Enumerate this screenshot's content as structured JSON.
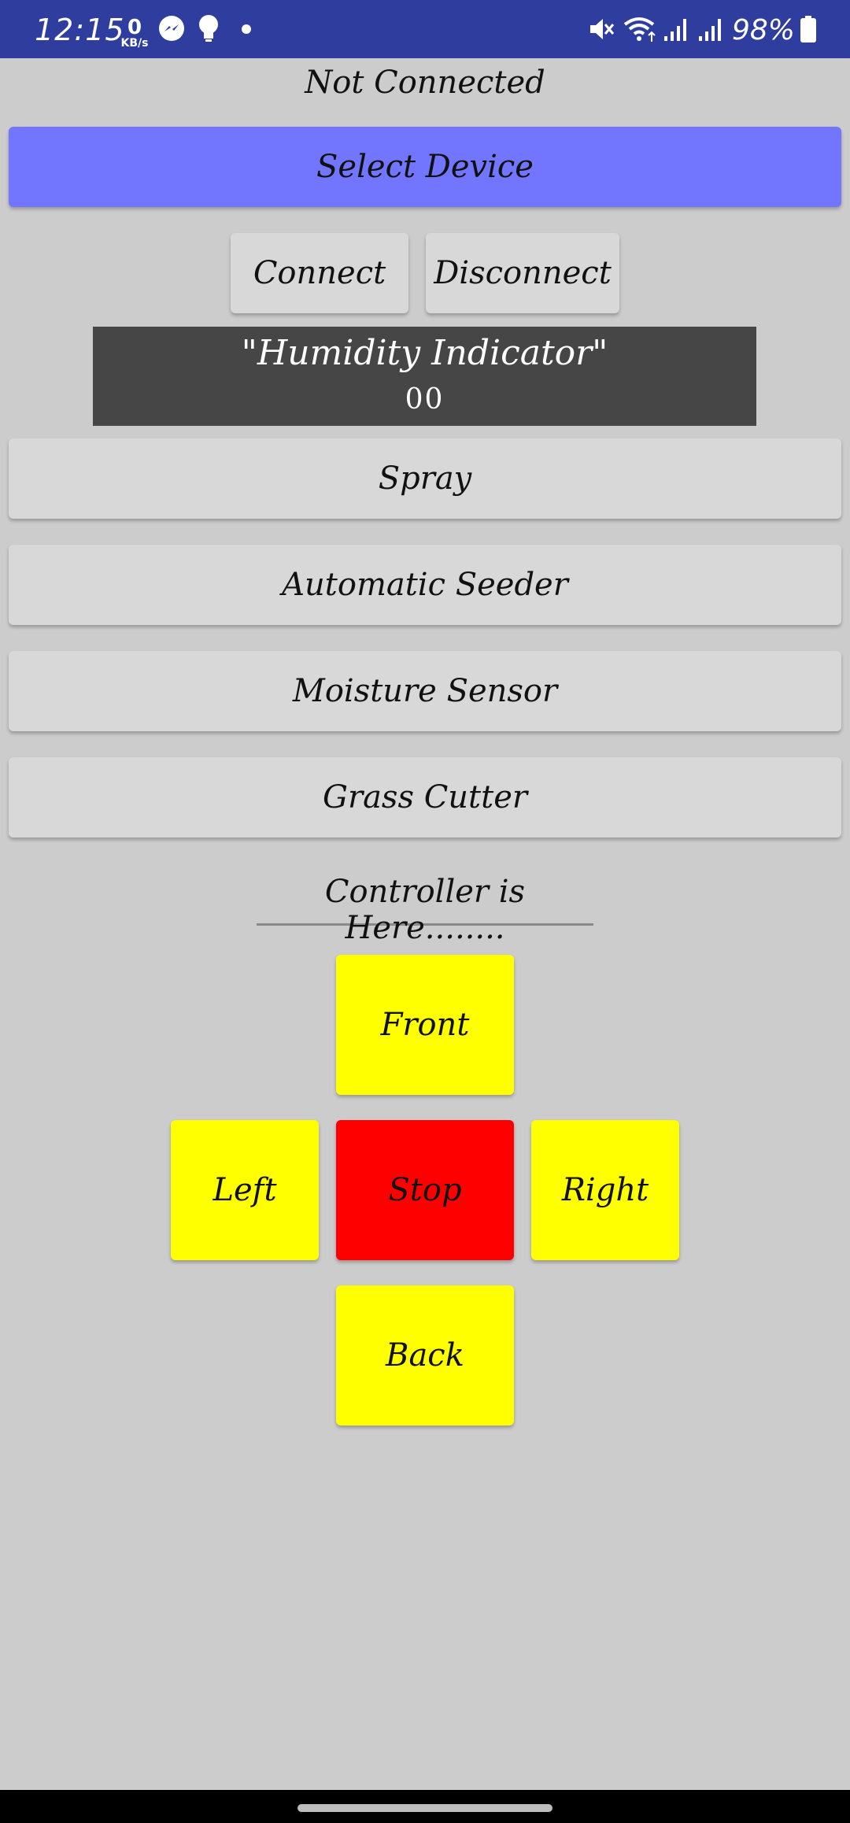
{
  "status_bar": {
    "time": "12:15",
    "net_speed_value": "0",
    "net_speed_unit": "KB/s",
    "battery": "98%",
    "icons": [
      "messenger-icon",
      "bulb-icon",
      "dot-icon",
      "mute-icon",
      "wifi-icon",
      "signal-icon",
      "signal-icon",
      "battery-icon"
    ]
  },
  "connection_status": "Not Connected",
  "buttons": {
    "select_device": "Select Device",
    "connect": "Connect",
    "disconnect": "Disconnect",
    "spray": "Spray",
    "automatic_seeder": "Automatic Seeder",
    "moisture_sensor": "Moisture Sensor",
    "grass_cutter": "Grass Cutter"
  },
  "humidity": {
    "title": "\"Humidity Indicator\"",
    "value": "00"
  },
  "controller": {
    "label": "Controller is Here........",
    "front": "Front",
    "left": "Left",
    "stop": "Stop",
    "right": "Right",
    "back": "Back"
  },
  "colors": {
    "status_bar": "#2f3e9e",
    "background": "#cccccc",
    "select_device": "#7276ff",
    "direction": "#ffff00",
    "stop": "#ff0000",
    "humidity_panel": "#464646"
  }
}
